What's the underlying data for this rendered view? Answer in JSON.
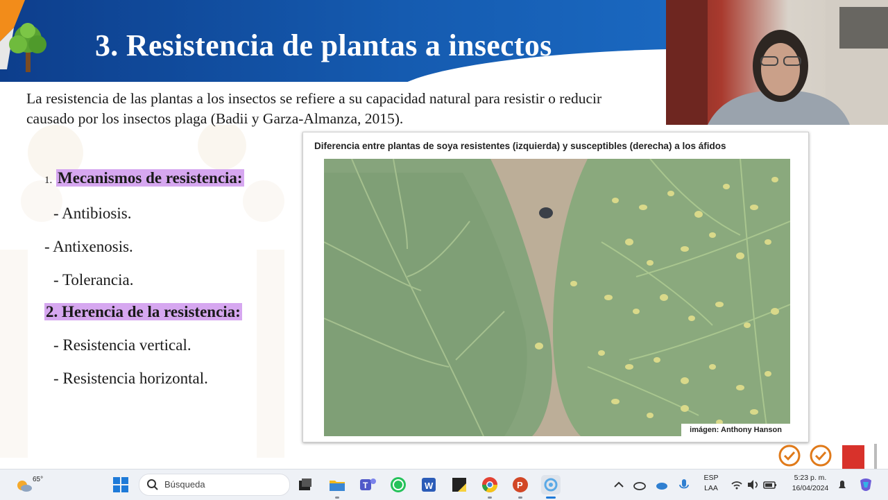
{
  "slide": {
    "title": "3. Resistencia de plantas a insectos",
    "intro_line1": "La resistencia de las plantas a los insectos se refiere a su capacidad natural para resistir o reducir",
    "intro_line2": "causado por los insectos plaga (Badii y Garza-Almanza, 2015).",
    "list": {
      "item1_number": "1.",
      "item1_heading": "Mecanismos de resistencia:",
      "item1_sub1": "- Antibiosis.",
      "item1_sub2": "- Antixenosis.",
      "item1_sub3": "- Tolerancia.",
      "item2_heading": "2. Herencia de la resistencia:",
      "item2_sub1": "- Resistencia vertical.",
      "item2_sub2": "- Resistencia horizontal."
    },
    "figure": {
      "caption": "Diferencia entre plantas de soya resistentes (izquierda) y susceptibles (derecha) a los áfidos",
      "credit": "imágen: Anthony Hanson"
    },
    "highlight_color": "#d6a7f0",
    "banner_color": "#0d3e8c"
  },
  "taskbar": {
    "weather_temp": "65°",
    "search_placeholder": "Búsqueda",
    "language_line1": "ESP",
    "language_line2": "LAA",
    "time": "5:23 p. m.",
    "date": "16/04/2024"
  }
}
